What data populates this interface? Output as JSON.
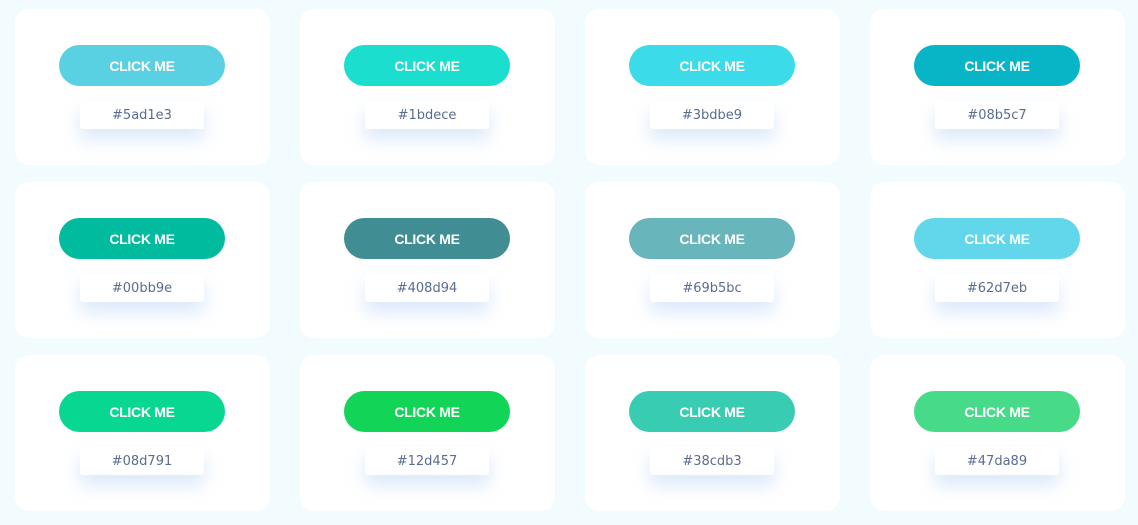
{
  "button_label": "CLICK ME",
  "cards": [
    {
      "color": "#5ad1e3",
      "code": "#5ad1e3"
    },
    {
      "color": "#1bdece",
      "code": "#1bdece"
    },
    {
      "color": "#3bdbe9",
      "code": "#3bdbe9"
    },
    {
      "color": "#08b5c7",
      "code": "#08b5c7"
    },
    {
      "color": "#00bb9e",
      "code": "#00bb9e"
    },
    {
      "color": "#408d94",
      "code": "#408d94"
    },
    {
      "color": "#69b5bc",
      "code": "#69b5bc"
    },
    {
      "color": "#62d7eb",
      "code": "#62d7eb"
    },
    {
      "color": "#08d791",
      "code": "#08d791"
    },
    {
      "color": "#12d457",
      "code": "#12d457"
    },
    {
      "color": "#38cdb3",
      "code": "#38cdb3"
    },
    {
      "color": "#47da89",
      "code": "#47da89"
    }
  ]
}
